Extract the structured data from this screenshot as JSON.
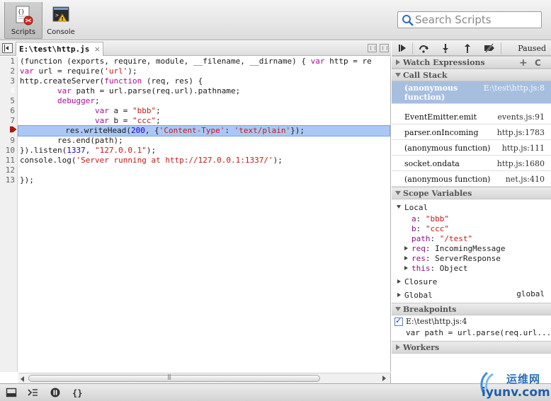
{
  "toolbar": {
    "scripts_label": "Scripts",
    "console_label": "Console",
    "search_placeholder": "Search Scripts"
  },
  "editor": {
    "tab_label": "E:\\test\\http.js",
    "tab_close": "×",
    "current_line": 8,
    "breakpoint_line": 4,
    "line_numbers": [
      "1",
      "2",
      "3",
      "4",
      "5",
      "6",
      "7",
      "",
      "9",
      "10",
      "11",
      "12",
      "13"
    ],
    "code": {
      "l1_a": "(function (exports, require, module, __filename, __dirname) { ",
      "l1_b": "var",
      "l1_c": " http = re",
      "l2_a": "var",
      "l2_b": " url = require(",
      "l2_c": "'url'",
      "l2_d": ");",
      "l3_a": "http.createServer(",
      "l3_b": "function",
      "l3_c": " (req, res) {",
      "l4_a": "        ",
      "l4_b": "var",
      "l4_c": " path = url.parse(req.url).pathname;",
      "l5_a": "        ",
      "l5_b": "debugger",
      "l5_c": ";",
      "l6_a": "                ",
      "l6_b": "var",
      "l6_c": " a = ",
      "l6_d": "\"bbb\"",
      "l6_e": ";",
      "l7_a": "                ",
      "l7_b": "var",
      "l7_c": " b = ",
      "l7_d": "\"ccc\"",
      "l7_e": ";",
      "l8_a": "        res.writeHead(",
      "l8_b": "200",
      "l8_c": ", {",
      "l8_d": "'Content-Type'",
      "l8_e": ": ",
      "l8_f": "'text/plain'",
      "l8_g": "});",
      "l9": "        res.end(path);",
      "l10_a": "}).listen(",
      "l10_b": "1337",
      "l10_c": ", ",
      "l10_d": "\"127.0.0.1\"",
      "l10_e": ");",
      "l11_a": "console.log(",
      "l11_b": "'Server running at http://127.0.0.1:1337/'",
      "l11_c": ");",
      "l12": "",
      "l13": "});"
    }
  },
  "debugger": {
    "paused_label": "Paused"
  },
  "panes": {
    "watch_expressions": "Watch Expressions",
    "watch_add": "+",
    "watch_refresh": "C",
    "call_stack": "Call Stack",
    "scope_variables": "Scope Variables",
    "breakpoints": "Breakpoints",
    "workers": "Workers"
  },
  "call_stack": [
    {
      "func": "(anonymous function)",
      "loc": "E:\\test\\http.js:8"
    },
    {
      "func": "EventEmitter.emit",
      "loc": "events.js:91"
    },
    {
      "func": "parser.onIncoming",
      "loc": "http.js:1783"
    },
    {
      "func": "(anonymous function)",
      "loc": "http.js:111"
    },
    {
      "func": "socket.ondata",
      "loc": "http.js:1680"
    },
    {
      "func": "(anonymous function)",
      "loc": "net.js:410"
    }
  ],
  "scope": {
    "local_label": "Local",
    "a_name": "a",
    "a_value": "\"bbb\"",
    "b_name": "b",
    "b_value": "\"ccc\"",
    "path_name": "path",
    "path_value": "\"/test\"",
    "req_name": "req",
    "req_value": "IncomingMessage",
    "res_name": "res",
    "res_value": "ServerResponse",
    "this_name": "this",
    "this_value": "Object",
    "closure_label": "Closure",
    "global_label": "Global",
    "global_value": "global"
  },
  "breakpoints_list": [
    {
      "location": "E:\\test\\http.js:4",
      "snippet": "var path = url.parse(req.url..."
    }
  ],
  "watermark": {
    "cn": "运维网",
    "en": "iyunv.com"
  },
  "colors": {
    "selection": "#aac7f6",
    "breakpoint_marker": "#3a7bd5",
    "call_stack_selected": "#a7bfdf",
    "keyword": "#aa0d91",
    "string": "#c41a16",
    "number": "#1c00cf"
  }
}
